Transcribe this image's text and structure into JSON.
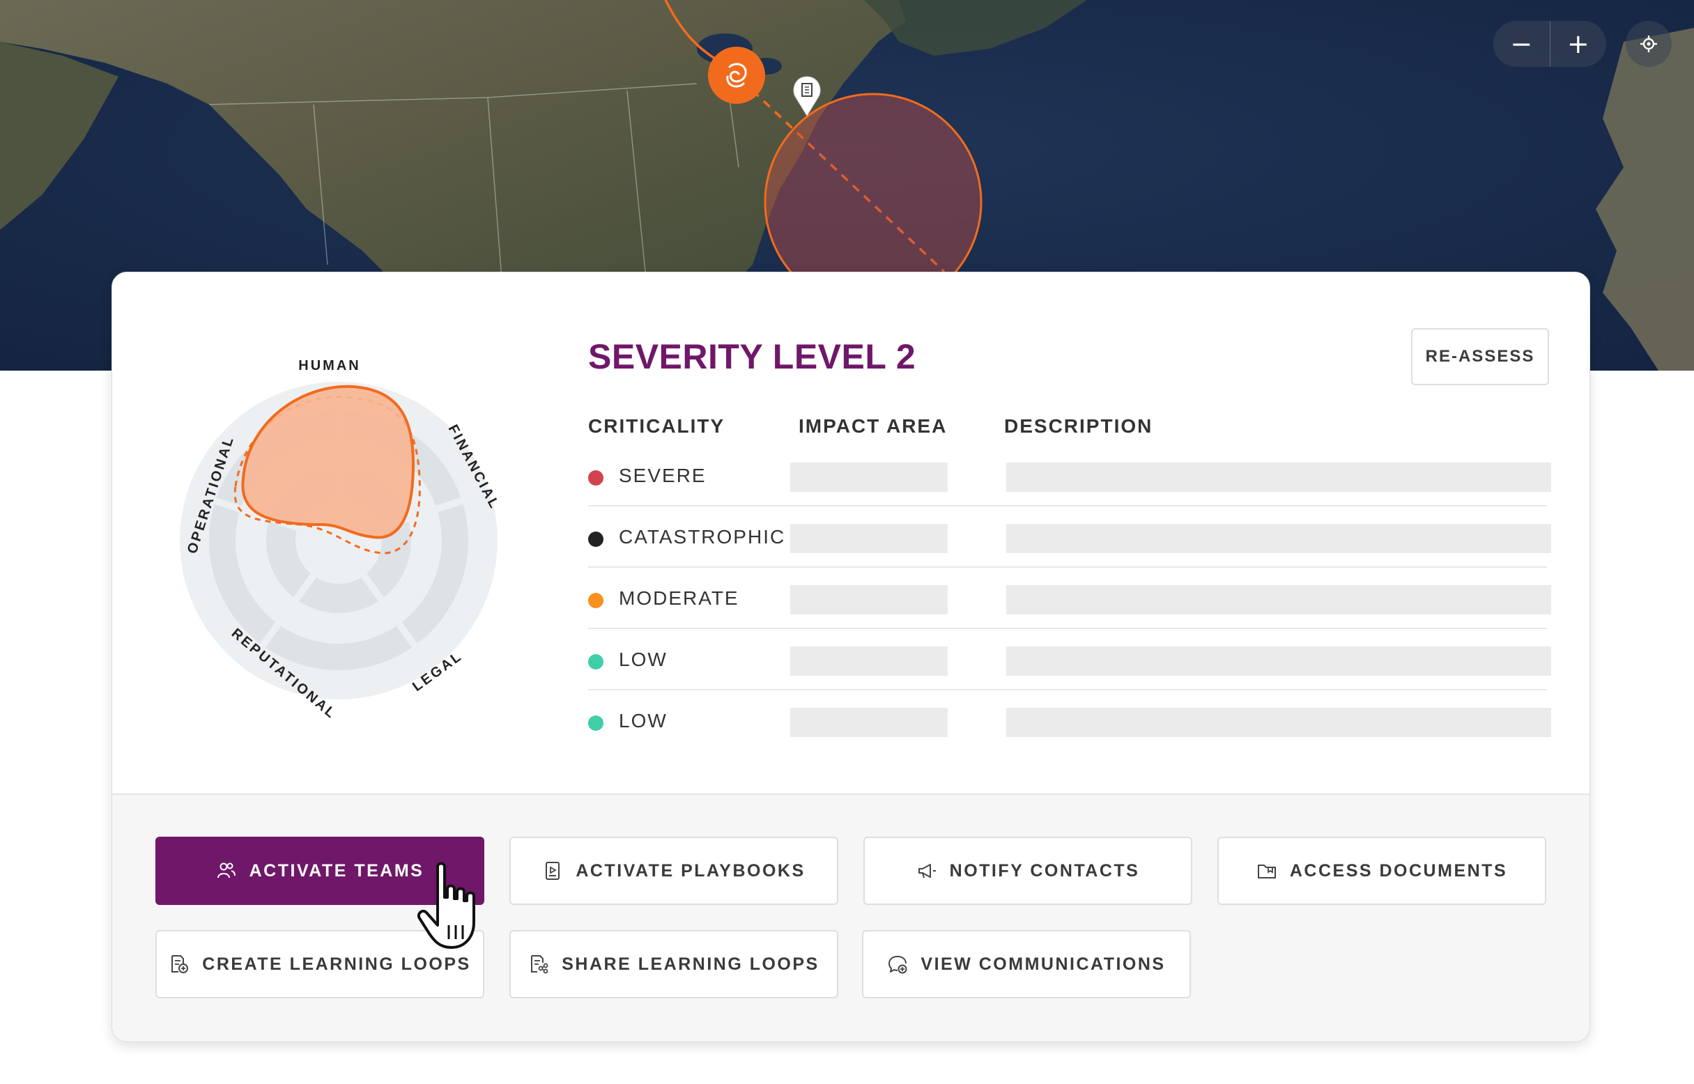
{
  "map": {
    "zoom_out_label": "−",
    "zoom_in_label": "+",
    "locate_icon": "crosshair-icon",
    "storm_icon": "hurricane-icon",
    "facility_icon": "building-pin-icon",
    "colors": {
      "storm": "#f26b1d",
      "impact_zone": "#c2554a"
    }
  },
  "radar": {
    "axes": [
      "HUMAN",
      "FINANCIAL",
      "LEGAL",
      "REPUTATIONAL",
      "OPERATIONAL"
    ],
    "colors": {
      "fill": "#f7b592",
      "stroke": "#f26b1d",
      "rings": "#e3e7ea"
    }
  },
  "severity": {
    "title": "SEVERITY LEVEL 2",
    "reassess_label": "RE-ASSESS"
  },
  "table": {
    "headers": {
      "criticality": "CRITICALITY",
      "impact_area": "IMPACT AREA",
      "description": "DESCRIPTION"
    },
    "rows": [
      {
        "criticality": "SEVERE",
        "color": "#d1434f"
      },
      {
        "criticality": "CATASTROPHIC",
        "color": "#222222"
      },
      {
        "criticality": "MODERATE",
        "color": "#f7901e"
      },
      {
        "criticality": "LOW",
        "color": "#3ecfa8"
      },
      {
        "criticality": "LOW",
        "color": "#3ecfa8"
      }
    ]
  },
  "actions": {
    "activate_teams": "ACTIVATE TEAMS",
    "activate_playbooks": "ACTIVATE PLAYBOOKS",
    "notify_contacts": "NOTIFY CONTACTS",
    "access_documents": "ACCESS DOCUMENTS",
    "create_learning_loops": "CREATE LEARNING LOOPS",
    "share_learning_loops": "SHARE LEARNING LOOPS",
    "view_communications": "VIEW COMMUNICATIONS"
  },
  "theme": {
    "brand": "#6f1869"
  }
}
